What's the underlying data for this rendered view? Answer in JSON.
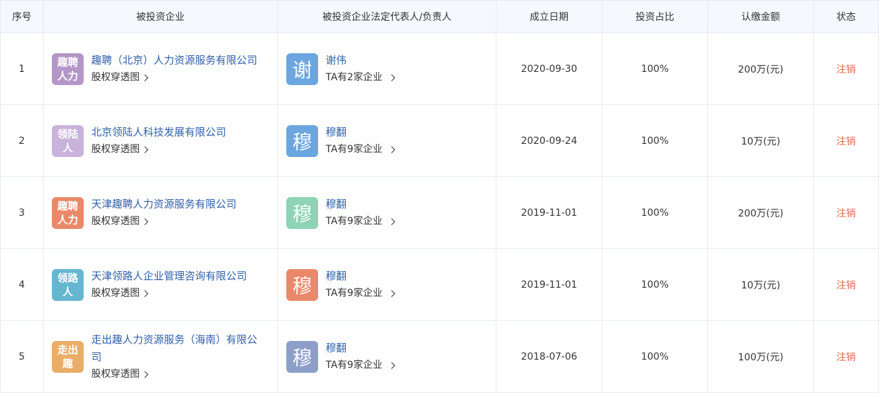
{
  "headers": {
    "index": "序号",
    "company": "被投资企业",
    "representative": "被投资企业法定代表人/负责人",
    "date": "成立日期",
    "ratio": "投资占比",
    "amount": "认缴金额",
    "status": "状态"
  },
  "rows": [
    {
      "index": "1",
      "logo_text": "趣聘人力",
      "logo_color": "#b497c8",
      "company": "趣聘（北京）人力资源服务有限公司",
      "equity_link": "股权穿透图",
      "rep_avatar": "谢",
      "rep_color": "#6ba6de",
      "rep_name": "谢伟",
      "rep_count": "TA有2家企业",
      "date": "2020-09-30",
      "ratio": "100%",
      "amount": "200万(元)",
      "status": "注销"
    },
    {
      "index": "2",
      "logo_text": "领陆人",
      "logo_color": "#c9b3db",
      "company": "北京领陆人科技发展有限公司",
      "equity_link": "股权穿透图",
      "rep_avatar": "穆",
      "rep_color": "#6ba6de",
      "rep_name": "穆翻",
      "rep_count": "TA有9家企业",
      "date": "2020-09-24",
      "ratio": "100%",
      "amount": "10万(元)",
      "status": "注销"
    },
    {
      "index": "3",
      "logo_text": "趣聘人力",
      "logo_color": "#e9896a",
      "company": "天津趣聘人力资源服务有限公司",
      "equity_link": "股权穿透图",
      "rep_avatar": "穆",
      "rep_color": "#8dd3b4",
      "rep_name": "穆翻",
      "rep_count": "TA有9家企业",
      "date": "2019-11-01",
      "ratio": "100%",
      "amount": "200万(元)",
      "status": "注销"
    },
    {
      "index": "4",
      "logo_text": "领路人",
      "logo_color": "#67b6d0",
      "company": "天津领路人企业管理咨询有限公司",
      "equity_link": "股权穿透图",
      "rep_avatar": "穆",
      "rep_color": "#e9896a",
      "rep_name": "穆翻",
      "rep_count": "TA有9家企业",
      "date": "2019-11-01",
      "ratio": "100%",
      "amount": "10万(元)",
      "status": "注销"
    },
    {
      "index": "5",
      "logo_text": "走出趣",
      "logo_color": "#e9ad6a",
      "company": "走出趣人力资源服务（海南）有限公司",
      "equity_link": "股权穿透图",
      "rep_avatar": "穆",
      "rep_color": "#8d9fc9",
      "rep_name": "穆翻",
      "rep_count": "TA有9家企业",
      "date": "2018-07-06",
      "ratio": "100%",
      "amount": "100万(元)",
      "status": "注销"
    }
  ]
}
